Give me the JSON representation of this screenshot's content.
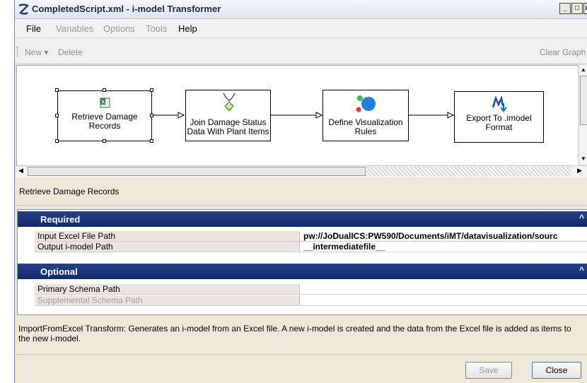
{
  "window": {
    "title": "CompletedScript.xml - i-model Transformer",
    "controls": {
      "minimize": "_",
      "maximize": "□",
      "close": "x"
    }
  },
  "menu": [
    {
      "label": "File",
      "enabled": true
    },
    {
      "label": "Variables",
      "enabled": false
    },
    {
      "label": "Options",
      "enabled": false
    },
    {
      "label": "Tools",
      "enabled": false
    },
    {
      "label": "Help",
      "enabled": true
    }
  ],
  "toolbar": {
    "new_label": "New",
    "new_dropdown": "▾",
    "delete_label": "Delete",
    "clear_graph_label": "Clear Graph"
  },
  "graph": {
    "nodes": [
      {
        "label": "Retrieve Damage Records",
        "icon": "excel-icon",
        "selected": true
      },
      {
        "label": "Join Damage Status Data With Plant Items",
        "icon": "merge-icon",
        "selected": false
      },
      {
        "label": "Define Visualization Rules",
        "icon": "color-rules-icon",
        "selected": false
      },
      {
        "label": "Export To .imodel Format",
        "icon": "export-icon",
        "selected": false
      }
    ]
  },
  "selected_node_title": "Retrieve Damage Records",
  "properties": {
    "required": {
      "title": "Required",
      "rows": [
        {
          "name": "Input Excel File Path",
          "value": "pw://JoDualICS:PW590/Documents/iMT/datavisualization/sourc"
        },
        {
          "name": "Output i-model Path",
          "value": "__intermediatefile__"
        }
      ]
    },
    "optional": {
      "title": "Optional",
      "rows": [
        {
          "name": "Primary Schema Path",
          "value": ""
        },
        {
          "name": "Supplemental Schema Path",
          "value": ""
        }
      ]
    },
    "collapse_glyph": "^"
  },
  "description": "ImportFromExcel Transform: Generates an i-model from an Excel file. A new i-model is created and the data from the Excel file is added as items to the new i-model.",
  "buttons": {
    "save": "Save",
    "close": "Close"
  }
}
